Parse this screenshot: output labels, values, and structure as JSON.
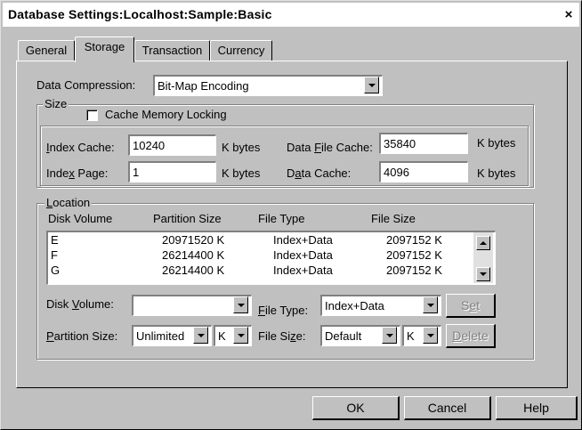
{
  "window": {
    "title": "Database Settings:Localhost:Sample:Basic",
    "close_label": "×"
  },
  "tabs": [
    {
      "label": "General"
    },
    {
      "label": "Storage"
    },
    {
      "label": "Transaction"
    },
    {
      "label": "Currency"
    }
  ],
  "compression": {
    "label": "Data Compression:",
    "value": "Bit-Map Encoding"
  },
  "size": {
    "group_label": "Size",
    "cache_locking_label": "Cache Memory Locking",
    "index_cache": {
      "label_pre": "",
      "label_u": "I",
      "label_post": "ndex Cache:",
      "value": "10240",
      "unit": "K bytes"
    },
    "index_page": {
      "label_pre": "Inde",
      "label_u": "x",
      "label_post": " Page:",
      "value": "1",
      "unit": "K bytes"
    },
    "data_file_cache": {
      "label_pre": "Data ",
      "label_u": "F",
      "label_post": "ile Cache:",
      "value": "35840",
      "unit": "K bytes"
    },
    "data_cache": {
      "label_pre": "D",
      "label_u": "a",
      "label_post": "ta Cache:",
      "value": "4096",
      "unit": "K bytes"
    }
  },
  "location": {
    "group_label_u": "L",
    "group_label_post": "ocation",
    "columns": [
      "Disk Volume",
      "Partition Size",
      "File Type",
      "File Size"
    ],
    "rows": [
      {
        "volume": "E",
        "partition": "20971520 K",
        "type": "Index+Data",
        "size": "2097152 K"
      },
      {
        "volume": "F",
        "partition": "26214400 K",
        "type": "Index+Data",
        "size": "2097152 K"
      },
      {
        "volume": "G",
        "partition": "26214400 K",
        "type": "Index+Data",
        "size": "2097152 K"
      }
    ],
    "disk_volume": {
      "label_pre": "Disk ",
      "label_u": "V",
      "label_post": "olume:",
      "value": ""
    },
    "file_type": {
      "label_pre": "",
      "label_u": "F",
      "label_post": "ile Type:",
      "value": "Index+Data"
    },
    "partition_size": {
      "label_pre": "",
      "label_u": "P",
      "label_post": "artition Size:",
      "value": "Unlimited",
      "unit": "K"
    },
    "file_size": {
      "label_pre": "File Si",
      "label_u": "z",
      "label_post": "e:",
      "value": "Default",
      "unit": "K"
    },
    "set_label_pre": "S",
    "set_label_u": "e",
    "set_label_post": "t",
    "delete_label_u": "D",
    "delete_label_post": "elete"
  },
  "buttons": {
    "ok": "OK",
    "cancel": "Cancel",
    "help": "Help"
  }
}
